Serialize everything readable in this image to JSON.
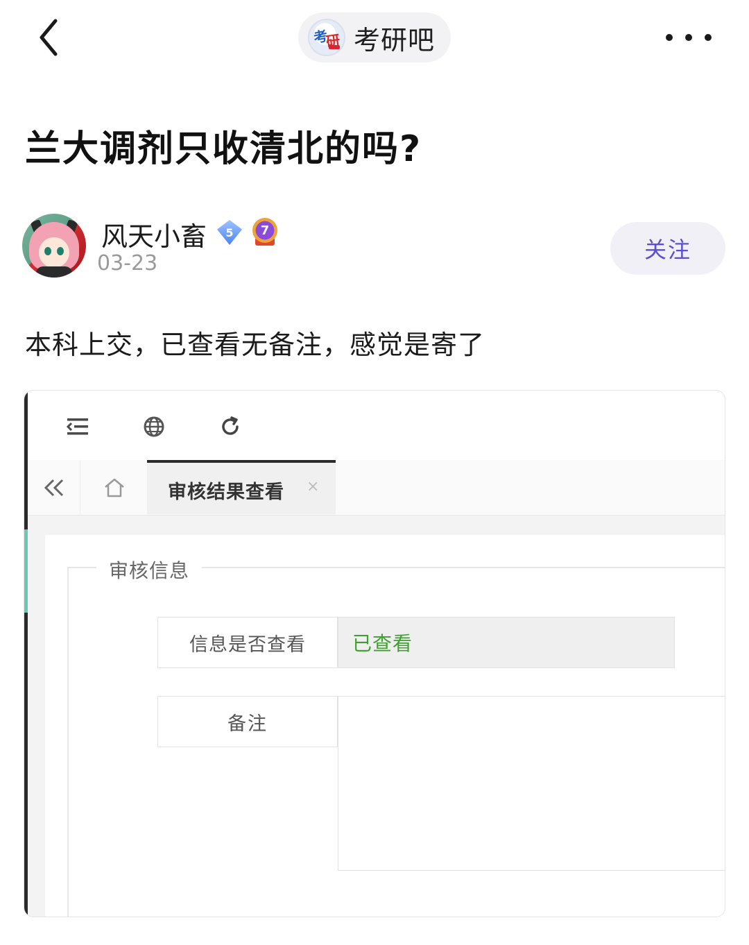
{
  "header": {
    "back_icon": "chevron-left-icon",
    "forum_name": "考研吧",
    "forum_logo_text": "考研",
    "more_icon": "more-horizontal-icon"
  },
  "post": {
    "title": "兰大调剂只收清北的吗?",
    "author": {
      "name": "风天小畜",
      "level_badge": "5",
      "medal_badge": "7",
      "date": "03-23"
    },
    "follow_label": "关注",
    "body": "本科上交，已查看无备注，感觉是寄了"
  },
  "embedded_screenshot": {
    "toolbar_icons": [
      "menu-collapse-icon",
      "globe-icon",
      "refresh-icon"
    ],
    "tabs": {
      "back_icon": "double-chevron-left-icon",
      "home_icon": "home-icon",
      "active_tab_label": "审核结果查看",
      "close_glyph": "×"
    },
    "section_legend": "审核信息",
    "fields": [
      {
        "label": "信息是否查看",
        "value": "已查看"
      },
      {
        "label": "备注",
        "value": ""
      }
    ],
    "colors": {
      "viewed_status": "#3f9f2f",
      "accent": "#6fc6b6"
    }
  },
  "colors": {
    "follow_text": "#5b4fd0",
    "follow_bg": "#f1f0f7",
    "date_text": "#9a9a9a"
  }
}
